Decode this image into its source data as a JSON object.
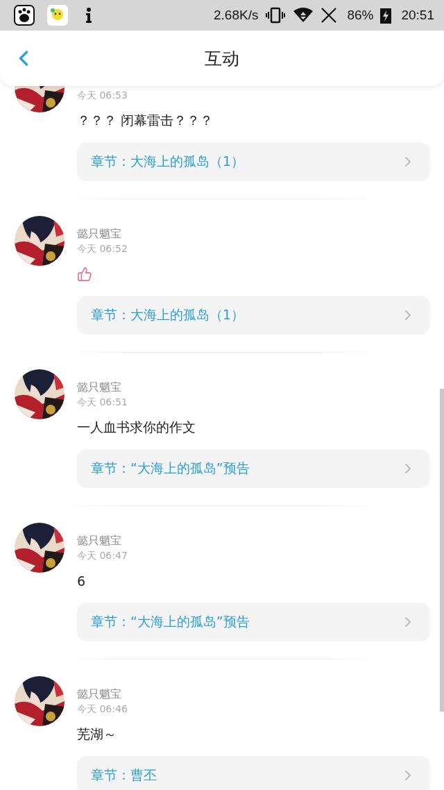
{
  "status_bar": {
    "net_speed": "2.68K/s",
    "battery": "86%",
    "time": "20:51"
  },
  "header": {
    "title": "互动"
  },
  "comments": [
    {
      "time": "今天 06:53",
      "content": {
        "kind": "text",
        "text": "？？？ 闭幕雷击？？？"
      },
      "chapter": "章节：大海上的孤岛（1）"
    },
    {
      "name": "懿只魈宝",
      "time": "今天 06:52",
      "content": {
        "kind": "thumbs_up"
      },
      "chapter": "章节：大海上的孤岛（1）"
    },
    {
      "name": "懿只魈宝",
      "time": "今天 06:51",
      "content": {
        "kind": "text",
        "text": "一人血书求你的作文"
      },
      "chapter": "章节：“大海上的孤岛”预告"
    },
    {
      "name": "懿只魈宝",
      "time": "今天 06:47",
      "content": {
        "kind": "text",
        "text": "6"
      },
      "chapter": "章节：“大海上的孤岛”预告"
    },
    {
      "name": "懿只魈宝",
      "time": "今天 06:46",
      "content": {
        "kind": "text",
        "text": "芜湖～"
      },
      "chapter": "章节：曹丕"
    }
  ]
}
